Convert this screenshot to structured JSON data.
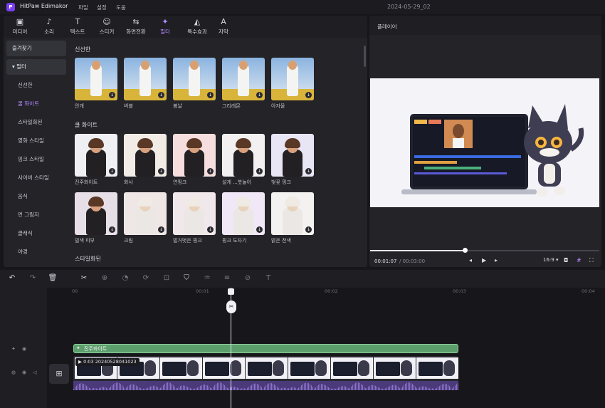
{
  "app": {
    "title": "HitPaw Edimakor",
    "logo": "P",
    "menu": [
      "파일",
      "설정",
      "도움"
    ],
    "project_name": "2024-05-29_02"
  },
  "tabs": [
    {
      "label": "미디어",
      "icon": "media-icon",
      "glyph": "▣"
    },
    {
      "label": "소리",
      "icon": "music-icon",
      "glyph": "♪"
    },
    {
      "label": "텍스트",
      "icon": "text-icon",
      "glyph": "T"
    },
    {
      "label": "스티커",
      "icon": "sticker-icon",
      "glyph": "☺"
    },
    {
      "label": "화면전환",
      "icon": "transition-icon",
      "glyph": "⇆"
    },
    {
      "label": "필터",
      "icon": "filter-icon",
      "glyph": "✦"
    },
    {
      "label": "특수효과",
      "icon": "effects-icon",
      "glyph": "◭"
    },
    {
      "label": "자막",
      "icon": "subtitle-icon",
      "glyph": "A"
    }
  ],
  "sidebar": {
    "favorites": "즐겨찾기",
    "filter_group": "필터",
    "items": [
      "신선한",
      "쿨 화이트",
      "스타일화된",
      "영화 스타일",
      "핑크 스타일",
      "사이버 스타일",
      "음식",
      "먼 그림자",
      "클래식",
      "야경"
    ]
  },
  "sections": [
    {
      "title": "신선한",
      "items": [
        {
          "label": "안개"
        },
        {
          "label": "버블"
        },
        {
          "label": "봄날"
        },
        {
          "label": "그리레몬"
        },
        {
          "label": "아자울"
        }
      ]
    },
    {
      "title": "쿨 화이트",
      "items": [
        {
          "label": "진주화이트"
        },
        {
          "label": "화사"
        },
        {
          "label": "연핑크"
        },
        {
          "label": "설게 ...붓놀이"
        },
        {
          "label": "벚꽃 핑크"
        },
        {
          "label": "밀색 피부"
        },
        {
          "label": "크림"
        },
        {
          "label": "벌거벗은 핑크"
        },
        {
          "label": "핑크 도자기"
        },
        {
          "label": "밝은 천색"
        }
      ]
    },
    {
      "title": "스타일화된",
      "items": []
    }
  ],
  "player": {
    "title": "플레이어",
    "current_time": "00:01:07",
    "total_time": "/ 00:03:00",
    "progress": 0.42,
    "aspect": "16:9 ▾"
  },
  "timeline": {
    "ticks": [
      "00",
      "00:01",
      "00:02",
      "00:03",
      "00:04"
    ],
    "effect_clip": "진주화이트",
    "video_clip": "0:03 20240528041023",
    "playhead": "00:01:07"
  }
}
